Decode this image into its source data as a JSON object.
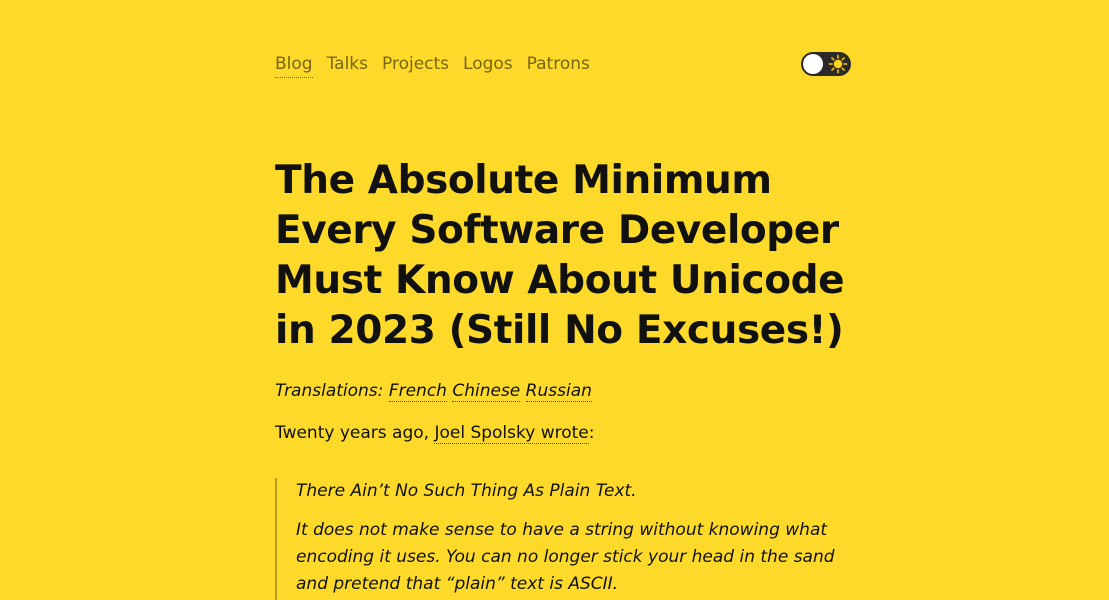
{
  "nav": {
    "items": [
      {
        "label": "Blog",
        "active": true
      },
      {
        "label": "Talks",
        "active": false
      },
      {
        "label": "Projects",
        "active": false
      },
      {
        "label": "Logos",
        "active": false
      },
      {
        "label": "Patrons",
        "active": false
      }
    ],
    "theme_toggle": {
      "state": "light",
      "icon": "sun-icon"
    }
  },
  "article": {
    "title": "The Absolute Minimum Every Software Developer Must Know About Unicode in 2023 (Still No Excuses!)",
    "translations_label": "Translations:",
    "translations": [
      "French",
      "Chinese",
      "Russian"
    ],
    "intro_prefix": "Twenty years ago, ",
    "intro_link": "Joel Spolsky wrote",
    "intro_suffix": ":",
    "quote": [
      "There Ain’t No Such Thing As Plain Text.",
      "It does not make sense to have a string without knowing what encoding it uses. You can no longer stick your head in the sand and pretend that “plain” text is ASCII."
    ]
  },
  "colors": {
    "background": "#fdda2a",
    "nav_text": "#7a6512",
    "text": "#111111",
    "toggle_bg": "#2b2a28",
    "quote_border": "#b89c1b"
  }
}
